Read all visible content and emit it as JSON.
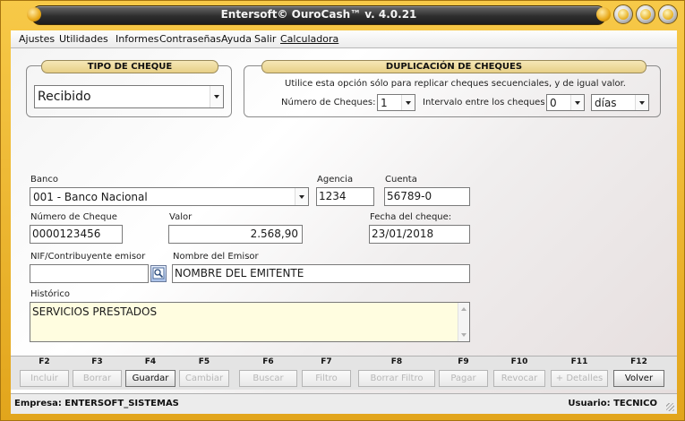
{
  "window": {
    "title": "Entersoft© OuroCash™ v. 4.0.21"
  },
  "menu": [
    {
      "label": "Ajustes"
    },
    {
      "label": "Utilidades"
    },
    {
      "label": "Informes"
    },
    {
      "label": "Contraseñas"
    },
    {
      "label": "Ayuda"
    },
    {
      "label": "Salir"
    },
    {
      "label": "Calculadora"
    }
  ],
  "tipo_cheque": {
    "header": "TIPO DE CHEQUE",
    "selected": "Recibido"
  },
  "duplicacion": {
    "header": "DUPLICACIÓN DE CHEQUES",
    "note": "Utilice esta opción sólo para replicar cheques secuenciales, y de igual valor.",
    "numero_label": "Número de Cheques:",
    "numero_value": "1",
    "intervalo_label": "Intervalo entre los cheques",
    "intervalo_value": "0",
    "unidad": "días"
  },
  "form": {
    "banco_label": "Banco",
    "banco_value": "001 - Banco Nacional",
    "agencia_label": "Agencia",
    "agencia_value": "1234",
    "cuenta_label": "Cuenta",
    "cuenta_value": "56789-0",
    "numero_cheque_label": "Número de Cheque",
    "numero_cheque_value": "0000123456",
    "valor_label": "Valor",
    "valor_value": "2.568,90",
    "fecha_label": "Fecha del cheque:",
    "fecha_value": "23/01/2018",
    "nif_label": "NIF/Contribuyente emisor",
    "nif_value": "",
    "nombre_label": "Nombre del Emisor",
    "nombre_value": "NOMBRE DEL EMITENTE",
    "historico_label": "Histórico",
    "historico_value": "SERVICIOS PRESTADOS"
  },
  "toolbar": [
    {
      "key": "F2",
      "label": "Incluir",
      "enabled": false
    },
    {
      "key": "F3",
      "label": "Borrar",
      "enabled": false
    },
    {
      "key": "F4",
      "label": "Guardar",
      "enabled": true
    },
    {
      "key": "F5",
      "label": "Cambiar",
      "enabled": false
    },
    {
      "key": "F6",
      "label": "Buscar",
      "enabled": false
    },
    {
      "key": "F7",
      "label": "Filtro",
      "enabled": false
    },
    {
      "key": "F8",
      "label": "Borrar Filtro",
      "enabled": false
    },
    {
      "key": "F9",
      "label": "Pagar",
      "enabled": false
    },
    {
      "key": "F10",
      "label": "Revocar",
      "enabled": false
    },
    {
      "key": "F11",
      "label": "+ Detalles",
      "enabled": false
    },
    {
      "key": "F12",
      "label": "Volver",
      "enabled": true
    }
  ],
  "status": {
    "empresa": "Empresa: ENTERSOFT_SISTEMAS",
    "usuario": "Usuario: TECNICO"
  },
  "colors": {
    "frame": "#f2c040",
    "title_bar": "#2e2e2e",
    "header_bg": "#eed89a",
    "historico_bg": "#fffde0"
  }
}
